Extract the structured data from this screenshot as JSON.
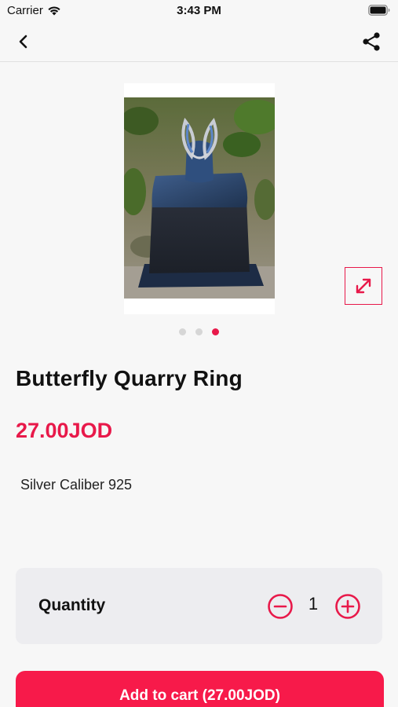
{
  "status_bar": {
    "carrier": "Carrier",
    "time": "3:43 PM"
  },
  "nav": {
    "back_icon": "chevron-left-icon",
    "share_icon": "share-icon"
  },
  "gallery": {
    "image_count": 3,
    "active_index": 2,
    "expand_icon": "expand-arrows-icon"
  },
  "product": {
    "title": "Butterfly Quarry Ring",
    "price": "27.00JOD",
    "description": "Silver Caliber 925"
  },
  "quantity": {
    "label": "Quantity",
    "value": "1"
  },
  "cart": {
    "button_label": "Add to cart (27.00JOD)"
  },
  "colors": {
    "accent": "#e8194a",
    "button": "#f71a4a"
  }
}
